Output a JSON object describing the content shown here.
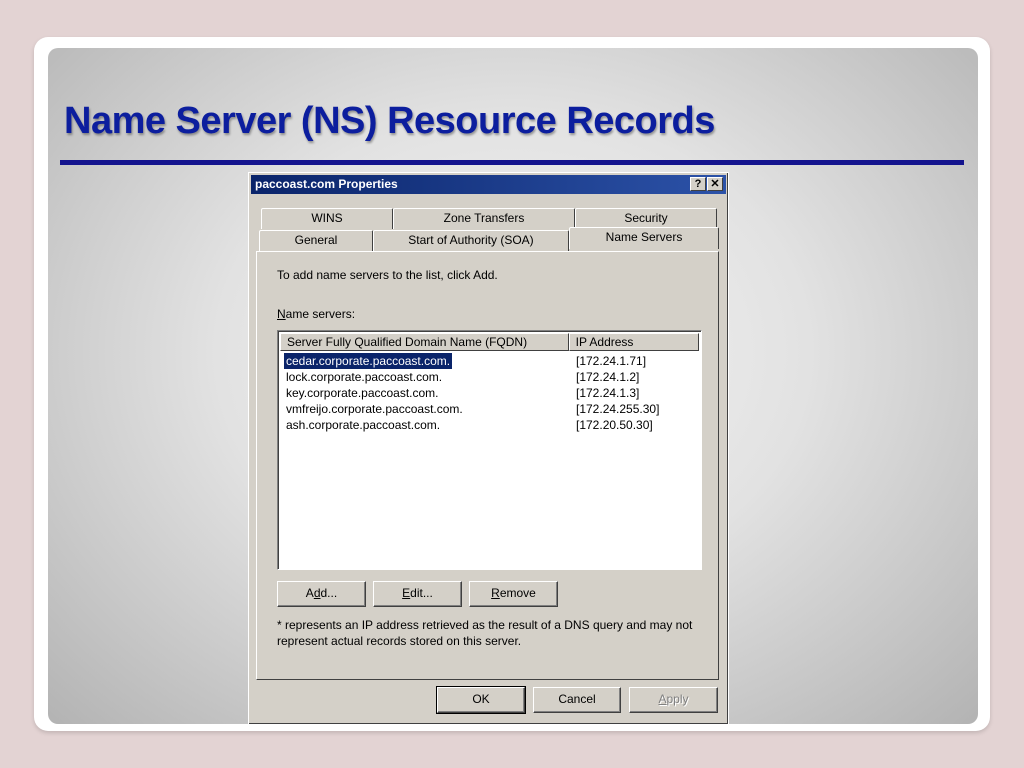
{
  "slide": {
    "title": "Name Server (NS) Resource Records"
  },
  "dialog": {
    "title": "paccoast.com Properties",
    "help_glyph": "?",
    "close_glyph": "✕",
    "tabs_back": [
      "WINS",
      "Zone Transfers",
      "Security"
    ],
    "tabs_front": [
      "General",
      "Start of Authority (SOA)",
      "Name Servers"
    ],
    "active_tab": "Name Servers",
    "instruction": "To add name servers to the list, click Add.",
    "ns_label_prefix": "N",
    "ns_label_rest": "ame servers:",
    "columns": [
      "Server Fully Qualified Domain Name (FQDN)",
      "IP Address"
    ],
    "rows": [
      {
        "fqdn": "cedar.corporate.paccoast.com.",
        "ip": "[172.24.1.71]"
      },
      {
        "fqdn": "lock.corporate.paccoast.com.",
        "ip": "[172.24.1.2]"
      },
      {
        "fqdn": "key.corporate.paccoast.com.",
        "ip": "[172.24.1.3]"
      },
      {
        "fqdn": "vmfreijo.corporate.paccoast.com.",
        "ip": "[172.24.255.30]"
      },
      {
        "fqdn": "ash.corporate.paccoast.com.",
        "ip": "[172.20.50.30]"
      }
    ],
    "buttons": {
      "add_pre": "A",
      "add_u": "d",
      "add_post": "d...",
      "edit_u": "E",
      "edit_post": "dit...",
      "remove_u": "R",
      "remove_post": "emove"
    },
    "note": "* represents an IP address retrieved as the result of a DNS query and may not represent actual records stored on this server.",
    "footer": {
      "ok": "OK",
      "cancel": "Cancel",
      "apply_u": "A",
      "apply_post": "pply"
    }
  },
  "colors": {
    "title": "#0c1e9e",
    "titlebar": "#0a246a",
    "dialog_face": "#d4d0c8",
    "selection": "#0a246a"
  }
}
